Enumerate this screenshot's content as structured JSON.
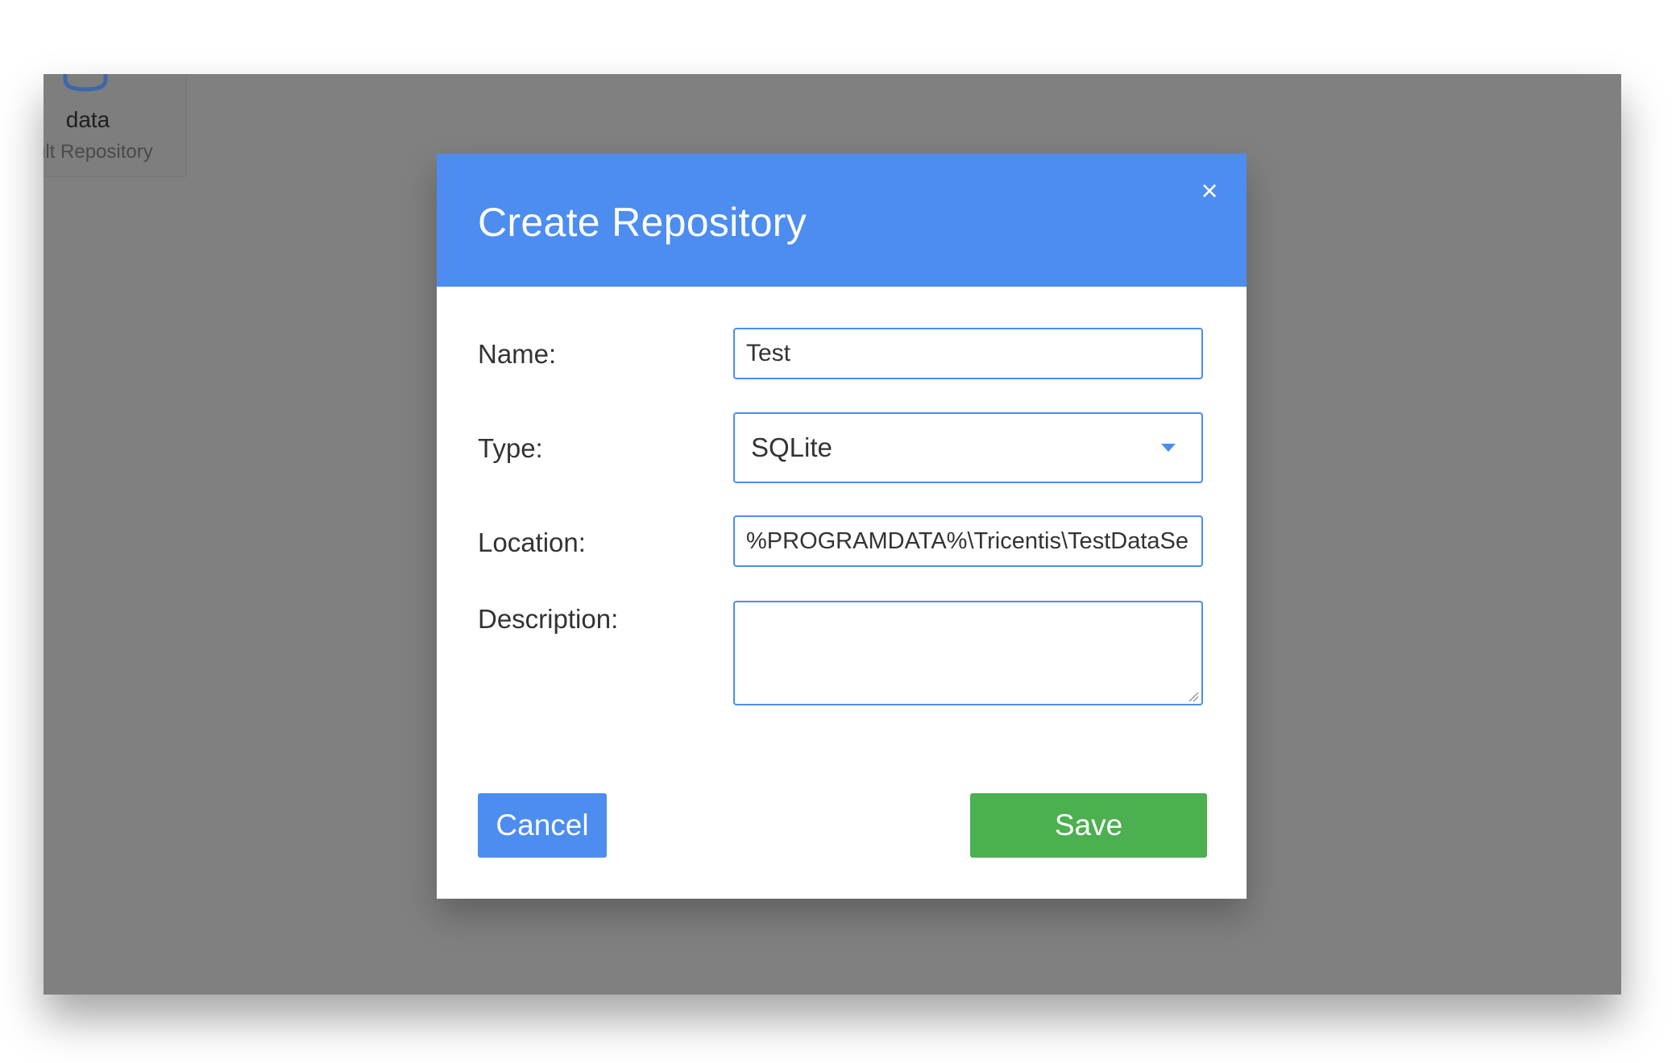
{
  "background": {
    "repository_card": {
      "icon": "database-icon",
      "name": "data",
      "subtitle": "ult Repository"
    }
  },
  "dialog": {
    "title": "Create Repository",
    "close_icon": "×",
    "fields": {
      "name": {
        "label": "Name:",
        "value": "Test"
      },
      "type": {
        "label": "Type:",
        "value": "SQLite"
      },
      "location": {
        "label": "Location:",
        "value": "%PROGRAMDATA%\\Tricentis\\TestDataServ"
      },
      "description": {
        "label": "Description:",
        "value": ""
      }
    },
    "buttons": {
      "cancel": "Cancel",
      "save": "Save"
    }
  },
  "colors": {
    "header": "#4c8def",
    "overlay": "#808080",
    "save_button": "#4caf50",
    "cancel_button": "#4c8def"
  }
}
